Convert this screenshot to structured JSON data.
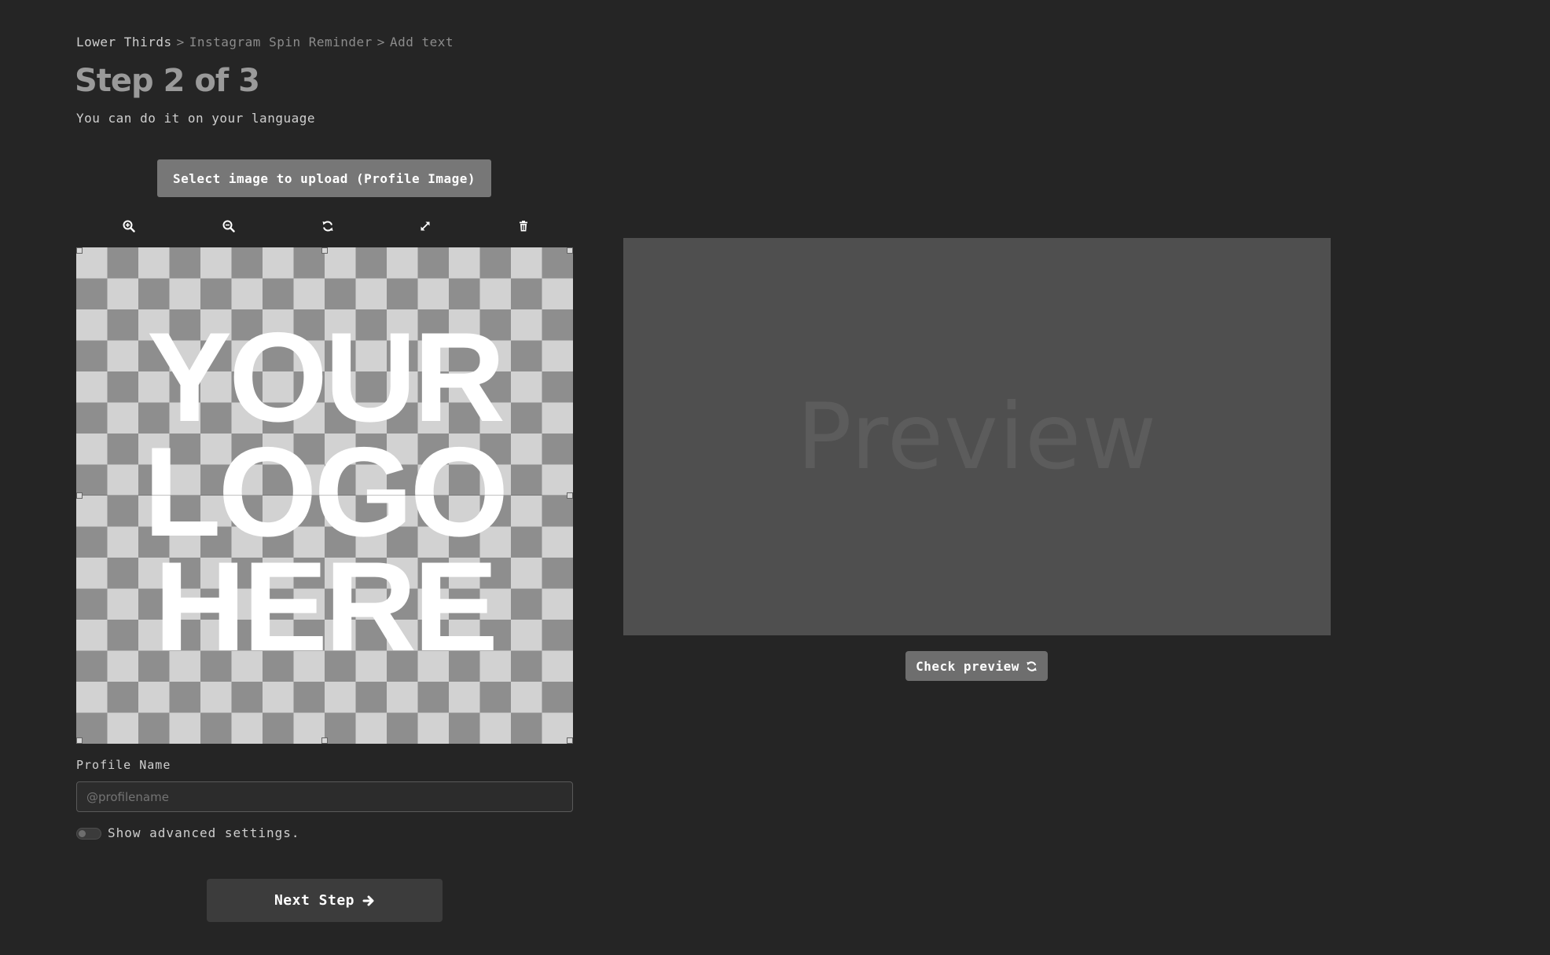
{
  "breadcrumb": {
    "items": [
      "Lower Thirds",
      "Instagram Spin Reminder",
      "Add text"
    ],
    "separator": ">"
  },
  "header": {
    "title": "Step 2 of 3",
    "subtitle": "You can do it on your language"
  },
  "uploader": {
    "button_label": "Select image to upload (Profile Image)",
    "toolbar_icons": [
      "zoom-in-icon",
      "zoom-out-icon",
      "rotate-icon",
      "expand-icon",
      "trash-icon"
    ],
    "placeholder_lines": [
      "YOUR",
      "LOGO",
      "HERE"
    ]
  },
  "profile": {
    "label": "Profile Name",
    "placeholder": "@profilename",
    "value": ""
  },
  "advanced": {
    "label": "Show advanced settings.",
    "enabled": false
  },
  "actions": {
    "next_label": "Next Step",
    "check_preview_label": "Check preview"
  },
  "preview": {
    "placeholder_text": "Preview"
  },
  "colors": {
    "background": "#252525",
    "title": "#9a9a9a",
    "button_gray": "#777777",
    "preview_bg": "#4f4f4f"
  }
}
